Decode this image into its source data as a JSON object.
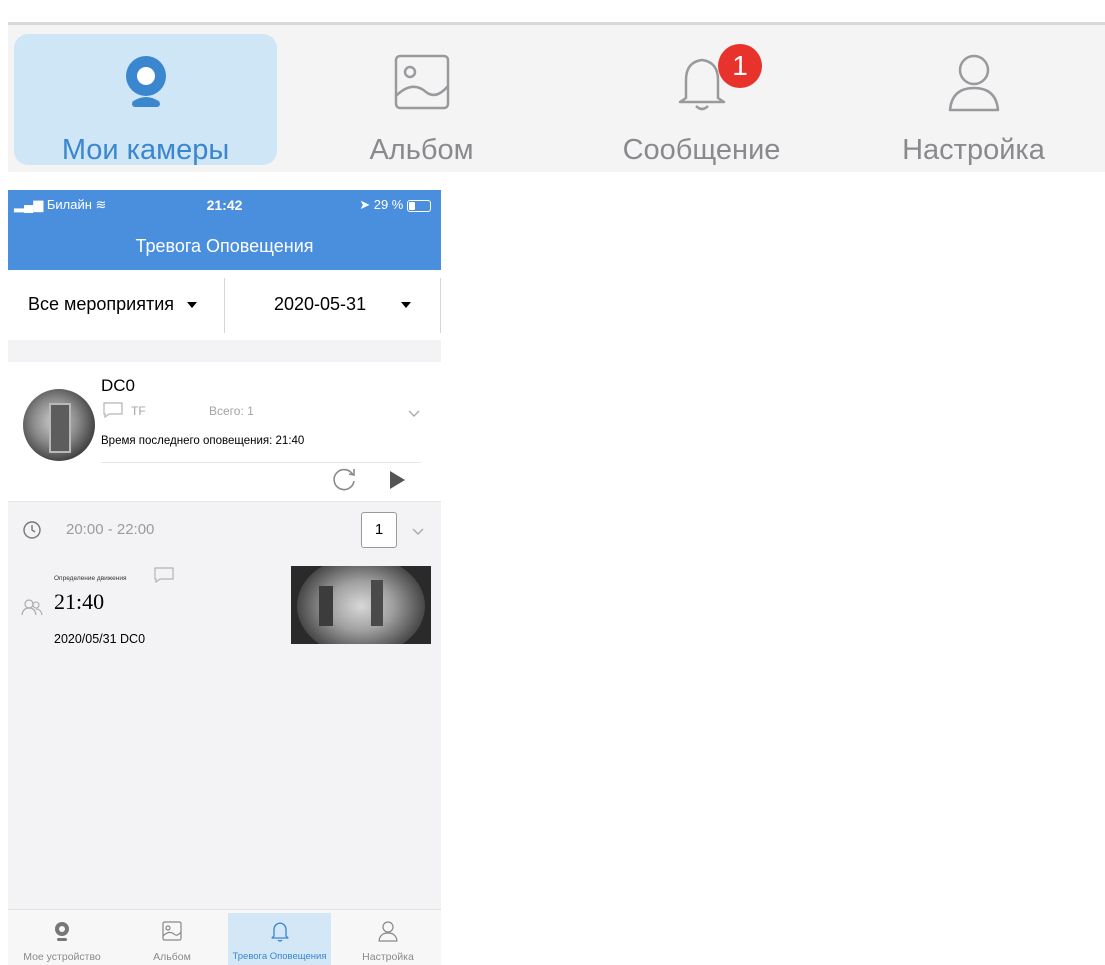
{
  "top_tabs": [
    {
      "label": "Мои камеры",
      "icon": "camera-icon",
      "active": true
    },
    {
      "label": "Альбом",
      "icon": "album-icon",
      "active": false
    },
    {
      "label": "Сообщение",
      "icon": "bell-icon",
      "active": false,
      "badge": "1"
    },
    {
      "label": "Настройка",
      "icon": "person-icon",
      "active": false
    }
  ],
  "status_bar": {
    "carrier": "Билайн",
    "time": "21:42",
    "battery": "29 %"
  },
  "header": {
    "title": "Тревога Оповещения"
  },
  "filters": {
    "events": "Все мероприятия",
    "date": "2020-05-31"
  },
  "device": {
    "name": "DC0",
    "storage": "TF",
    "total": "Всего: 1",
    "last_alert": "Время последнего оповещения: 21:40"
  },
  "time_group": {
    "range": "20:00 - 22:00",
    "count": "1"
  },
  "event": {
    "type": "Определение движения",
    "time": "21:40",
    "date_device": "2020/05/31   DC0"
  },
  "bottom_tabs": [
    {
      "label": "Мое устройство",
      "icon": "camera-icon",
      "active": false
    },
    {
      "label": "Альбом",
      "icon": "album-icon",
      "active": false
    },
    {
      "label": "Тревога Оповещения",
      "icon": "bell-icon",
      "active": true
    },
    {
      "label": "Настройка",
      "icon": "person-icon",
      "active": false
    }
  ],
  "colors": {
    "accent": "#4a8fdd",
    "active_tab": "#cfe6f6",
    "badge": "#e8332c"
  }
}
